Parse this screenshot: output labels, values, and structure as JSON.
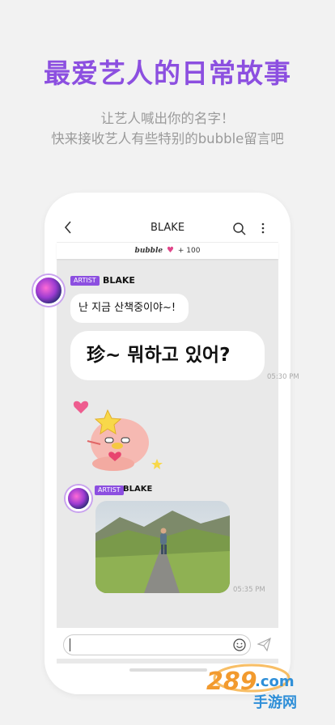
{
  "promo": {
    "headline": "最爱艺人的日常故事",
    "sub_line1": "让艺人喊出你的名字！",
    "sub_line2": "快来接收艺人有些特别的bubble留言吧"
  },
  "chat": {
    "header_title": "BLAKE",
    "bubble_logo": "bubble",
    "bubble_count": "+ 100",
    "artist_tag": "ARTIST",
    "artist_name": "BLAKE",
    "messages": [
      {
        "text": "난 지금 산책중이야~!"
      },
      {
        "text": "珍~ 뭐하고 있어?"
      }
    ],
    "time1": "05:30 PM",
    "time2": "05:35 PM"
  },
  "watermark": {
    "text": "289.com",
    "sub": "手游网"
  },
  "colors": {
    "accent": "#8c4fe0",
    "heart": "#e0468a"
  }
}
